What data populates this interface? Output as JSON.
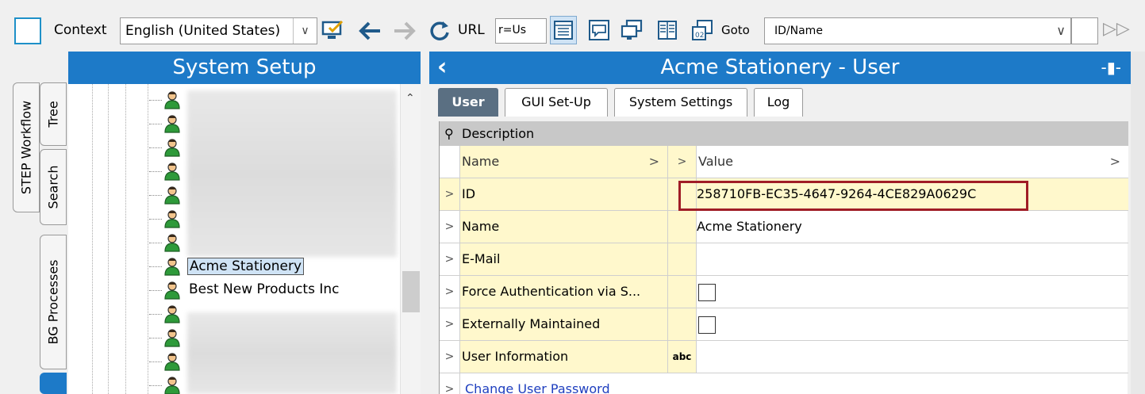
{
  "toolbar": {
    "context_label": "Context",
    "context_value": "English (United States)",
    "url_label": "URL",
    "url_value": "r=Us",
    "goto_label": "Goto",
    "goto_value": "ID/Name"
  },
  "side_tabs": [
    "STEP Workflow",
    "Tree",
    "Search",
    "BG Processes"
  ],
  "setup": {
    "title": "System Setup",
    "tree_nodes": [
      {
        "label": "",
        "selected": false
      },
      {
        "label": "",
        "selected": false
      },
      {
        "label": "",
        "selected": false
      },
      {
        "label": "",
        "selected": false
      },
      {
        "label": "",
        "selected": false
      },
      {
        "label": "",
        "selected": false
      },
      {
        "label": "",
        "selected": false
      },
      {
        "label": "Acme Stationery",
        "selected": true
      },
      {
        "label": "Best New Products Inc",
        "selected": false
      },
      {
        "label": "",
        "selected": false
      },
      {
        "label": "",
        "selected": false
      },
      {
        "label": "",
        "selected": false
      },
      {
        "label": "",
        "selected": false
      }
    ]
  },
  "user_panel": {
    "title": "Acme Stationery - User",
    "tabs": [
      "User",
      "GUI Set-Up",
      "System Settings",
      "Log"
    ],
    "section": "Description",
    "columns": {
      "name": "Name",
      "value": "Value"
    },
    "rows": [
      {
        "name": "ID",
        "type": "",
        "value": "258710FB-EC35-4647-9264-4CE829A0629C",
        "checkbox": false
      },
      {
        "name": "Name",
        "type": "",
        "value": "Acme Stationery",
        "checkbox": false
      },
      {
        "name": "E-Mail",
        "type": "",
        "value": "",
        "checkbox": false
      },
      {
        "name": "Force Authentication via S...",
        "type": "",
        "value": "",
        "checkbox": true
      },
      {
        "name": "Externally Maintained",
        "type": "",
        "value": "",
        "checkbox": true
      },
      {
        "name": "User Information",
        "type": "abc",
        "value": "",
        "checkbox": false
      }
    ],
    "link": "Change User Password"
  },
  "colors": {
    "accent": "#1d7ac8",
    "highlight": "#a01d26",
    "field_bg": "#fff8cc"
  }
}
